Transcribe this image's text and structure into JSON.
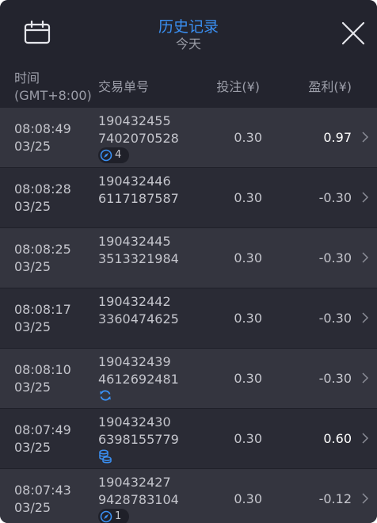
{
  "header": {
    "title": "历史记录",
    "subtitle": "今天",
    "calendar_icon": "calendar-icon",
    "close_icon": "close-icon"
  },
  "columns": {
    "time_line1": "时间",
    "time_line2": "(GMT+8:00)",
    "order_id": "交易单号",
    "bet": "投注(¥)",
    "profit": "盈利(¥)"
  },
  "colors": {
    "accent": "#3a8ff2",
    "background": "#23242e"
  },
  "rows": [
    {
      "time": "08:08:49",
      "date": "03/25",
      "id1": "190432455",
      "id2": "7402070528",
      "bet": "0.30",
      "profit": "0.97",
      "badge": "4",
      "icon": "compass-icon"
    },
    {
      "time": "08:08:28",
      "date": "03/25",
      "id1": "190432446",
      "id2": "6117187587",
      "bet": "0.30",
      "profit": "-0.30"
    },
    {
      "time": "08:08:25",
      "date": "03/25",
      "id1": "190432445",
      "id2": "3513321984",
      "bet": "0.30",
      "profit": "-0.30"
    },
    {
      "time": "08:08:17",
      "date": "03/25",
      "id1": "190432442",
      "id2": "3360474625",
      "bet": "0.30",
      "profit": "-0.30"
    },
    {
      "time": "08:08:10",
      "date": "03/25",
      "id1": "190432439",
      "id2": "4612692481",
      "bet": "0.30",
      "profit": "-0.30",
      "icon": "refresh-icon"
    },
    {
      "time": "08:07:49",
      "date": "03/25",
      "id1": "190432430",
      "id2": "6398155779",
      "bet": "0.30",
      "profit": "0.60",
      "icon": "coins-icon"
    },
    {
      "time": "08:07:43",
      "date": "03/25",
      "id1": "190432427",
      "id2": "9428783104",
      "bet": "0.30",
      "profit": "-0.12",
      "badge": "1",
      "icon": "compass-icon"
    }
  ]
}
